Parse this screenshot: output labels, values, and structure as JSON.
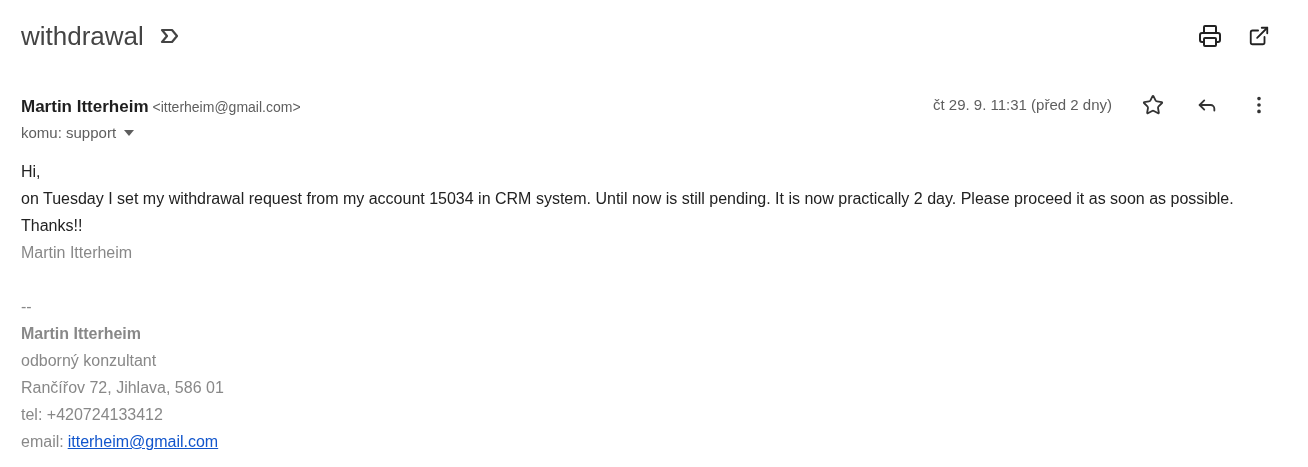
{
  "subject": {
    "title": "withdrawal"
  },
  "message": {
    "sender_name": "Martin Itterheim",
    "sender_email": "<itterheim@gmail.com>",
    "recipient": "komu: support",
    "date": "čt 29. 9. 11:31 (před 2 dny)",
    "starred": false
  },
  "body": [
    {
      "kind": "text",
      "text": "Hi,"
    },
    {
      "kind": "text",
      "text": "on Tuesday I set my withdrawal request from my account 15034 in CRM system. Until now is still pending. It is now practically 2 day. Please proceed it as soon as possible. Thanks!!"
    },
    {
      "kind": "muted",
      "text": "Martin Itterheim"
    }
  ],
  "signature": [
    {
      "kind": "separator",
      "text": "--"
    },
    {
      "kind": "name",
      "text": "Martin Itterheim"
    },
    {
      "kind": "line",
      "text": "odborný konzultant"
    },
    {
      "kind": "line",
      "text": "Rančířov 72, Jihlava, 586 01"
    },
    {
      "kind": "line",
      "text": "tel: +420724133412"
    },
    {
      "kind": "link",
      "label": "email:",
      "text": "itterheim@gmail.com"
    }
  ]
}
